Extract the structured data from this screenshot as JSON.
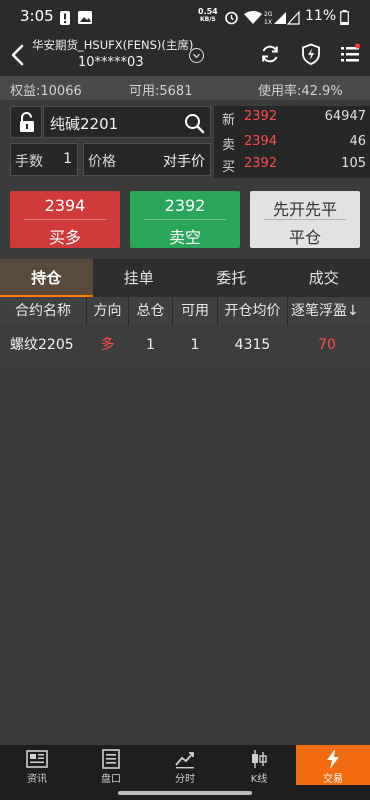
{
  "status_bar": {
    "time": "3:05",
    "net_speed_value": "0.54",
    "net_speed_unit": "KB/S",
    "battery": "11%"
  },
  "header": {
    "account_name": "华安期货_HSUFX(FENS)(主席)",
    "account_id": "10*****03"
  },
  "stats": {
    "equity": "权益:10066",
    "available": "可用:5681",
    "usage": "使用率:42.9%"
  },
  "order": {
    "symbol": "纯碱2201",
    "qty_label": "手数",
    "qty_value": "1",
    "price_label": "价格",
    "price_value": "对手价"
  },
  "quote": {
    "last_label": "新",
    "last_price": "2392",
    "last_volume": "64947",
    "ask_label": "卖",
    "ask_price": "2394",
    "ask_volume": "46",
    "bid_label": "买",
    "bid_price": "2392",
    "bid_volume": "105"
  },
  "actions": {
    "buy_price": "2394",
    "buy_label": "买多",
    "sell_price": "2392",
    "sell_label": "卖空",
    "close_mode": "先开先平",
    "close_label": "平仓"
  },
  "tabs": [
    "持仓",
    "挂单",
    "委托",
    "成交"
  ],
  "positions": {
    "columns": [
      "合约名称",
      "方向",
      "总仓",
      "可用",
      "开仓均价",
      "逐笔浮盈"
    ],
    "sort_indicator": "↓",
    "rows": [
      {
        "contract": "螺纹2205",
        "direction": "多",
        "total": "1",
        "available": "1",
        "avg_open": "4315",
        "pnl": "70"
      }
    ]
  },
  "bottom_nav": [
    "资讯",
    "盘口",
    "分时",
    "K线",
    "交易"
  ],
  "colors": {
    "up_red": "#ff4b4b",
    "buy_button": "#cf3b3b",
    "sell_button": "#2aa65a",
    "accent_orange": "#f26b0f"
  }
}
